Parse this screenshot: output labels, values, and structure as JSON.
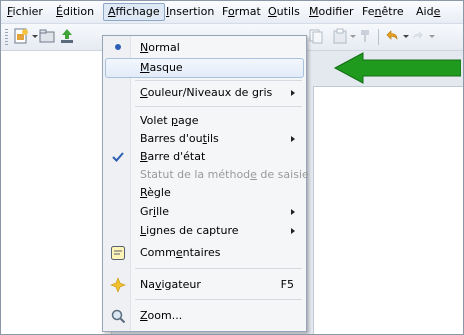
{
  "menubar": {
    "items": [
      {
        "pre": "",
        "key": "F",
        "post": "ichier"
      },
      {
        "pre": "",
        "key": "É",
        "post": "dition"
      },
      {
        "pre": "",
        "key": "A",
        "post": "ffichage"
      },
      {
        "pre": "",
        "key": "I",
        "post": "nsertion"
      },
      {
        "pre": "F",
        "key": "o",
        "post": "rmat"
      },
      {
        "pre": "",
        "key": "O",
        "post": "utils"
      },
      {
        "pre": "",
        "key": "M",
        "post": "odifier"
      },
      {
        "pre": "Fe",
        "key": "n",
        "post": "être"
      },
      {
        "pre": "Aid",
        "key": "e",
        "post": ""
      }
    ],
    "active_index": 2
  },
  "menu": {
    "normal": {
      "pre": "",
      "key": "N",
      "post": "ormal"
    },
    "masque": {
      "pre": "",
      "key": "M",
      "post": "asque"
    },
    "couleur": {
      "pre": "",
      "key": "C",
      "post": "ouleur/Niveaux de gris"
    },
    "volet": {
      "pre": "Volet ",
      "key": "p",
      "post": "age"
    },
    "barres_outils": {
      "pre": "Barres d'ou",
      "key": "t",
      "post": "ils"
    },
    "barre_etat": {
      "pre": "",
      "key": "B",
      "post": "arre d'état"
    },
    "statut": {
      "pre": "Statut de la méthod",
      "key": "e",
      "post": " de saisie"
    },
    "regle": {
      "pre": "",
      "key": "R",
      "post": "ègle"
    },
    "grille": {
      "pre": "Gr",
      "key": "i",
      "post": "lle"
    },
    "lignes": {
      "pre": "",
      "key": "L",
      "post": "ignes de capture"
    },
    "commentaires": {
      "pre": "Comm",
      "key": "e",
      "post": "ntaires"
    },
    "navigateur": {
      "pre": "Na",
      "key": "v",
      "post": "igateur"
    },
    "navigateur_shortcut": "F5",
    "zoom": {
      "pre": "",
      "key": "Z",
      "post": "oom..."
    }
  },
  "icons": {
    "normal": "radio-bullet-icon",
    "barre_etat": "checkmark-icon",
    "commentaires": "comments-icon",
    "navigateur": "navigator-star-icon",
    "zoom": "magnifier-icon"
  },
  "colors": {
    "accent_green": "#1f9a1f",
    "menu_hover": "#e2ecf8",
    "check_blue": "#2b5fb5"
  }
}
